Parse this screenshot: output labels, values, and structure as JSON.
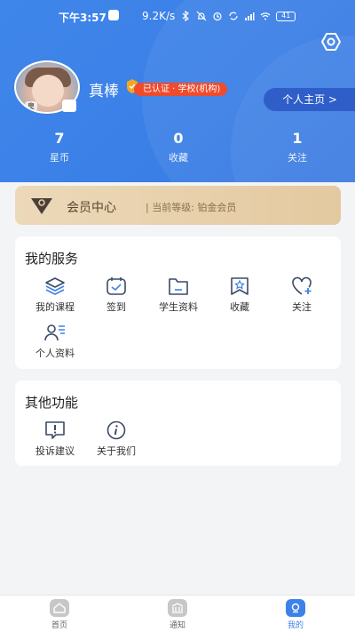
{
  "status_bar": {
    "time": "下午3:57",
    "network_speed": "9.2K/s",
    "battery": "41"
  },
  "profile": {
    "name": "真棒",
    "certification": "已认证 · 学校(机构)",
    "avatar_tag": "皇",
    "home_button": "个人主页 >"
  },
  "stats": [
    {
      "value": "7",
      "label": "星币"
    },
    {
      "value": "0",
      "label": "收藏"
    },
    {
      "value": "1",
      "label": "关注"
    }
  ],
  "vip": {
    "title": "会员中心",
    "level": "| 当前等级: 铂金会员"
  },
  "services": {
    "title": "我的服务",
    "items": [
      {
        "label": "我的课程",
        "icon": "layers-icon"
      },
      {
        "label": "签到",
        "icon": "calendar-check-icon"
      },
      {
        "label": "学生资料",
        "icon": "folder-icon"
      },
      {
        "label": "收藏",
        "icon": "bookmark-star-icon"
      },
      {
        "label": "关注",
        "icon": "heart-plus-icon"
      },
      {
        "label": "个人资料",
        "icon": "user-list-icon"
      }
    ]
  },
  "other": {
    "title": "其他功能",
    "items": [
      {
        "label": "投诉建议",
        "icon": "feedback-icon"
      },
      {
        "label": "关于我们",
        "icon": "info-icon"
      }
    ]
  },
  "tabbar": [
    {
      "label": "首页",
      "icon": "home-icon",
      "active": false
    },
    {
      "label": "通知",
      "icon": "notice-icon",
      "active": false
    },
    {
      "label": "我的",
      "icon": "profile-icon",
      "active": true
    }
  ],
  "colors": {
    "primary": "#3d82e8",
    "badge": "#ef4b2c",
    "vip_gold": "#e4c9a0"
  }
}
